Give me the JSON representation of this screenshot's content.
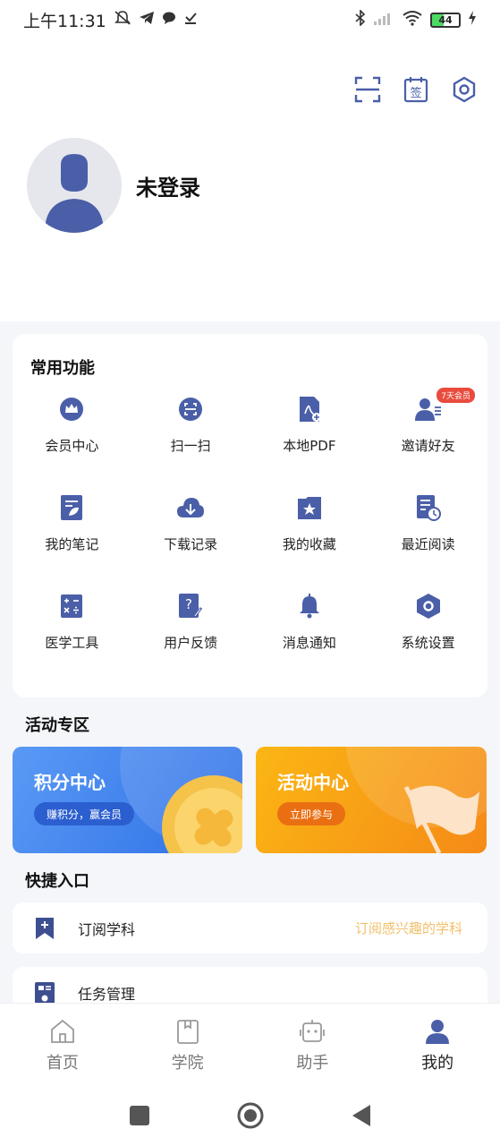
{
  "status_bar": {
    "time": "上午11:31",
    "battery": "44"
  },
  "profile": {
    "login_status": "未登录"
  },
  "top_icons": [
    "scan-icon",
    "sign-in-icon",
    "settings-icon"
  ],
  "functions": {
    "title": "常用功能",
    "badge": "7天会员",
    "items": [
      {
        "label": "会员中心",
        "icon": "crown-icon"
      },
      {
        "label": "扫一扫",
        "icon": "scan-icon"
      },
      {
        "label": "本地PDF",
        "icon": "pdf-icon"
      },
      {
        "label": "邀请好友",
        "icon": "invite-friend-icon"
      },
      {
        "label": "我的笔记",
        "icon": "notes-icon"
      },
      {
        "label": "下载记录",
        "icon": "download-cloud-icon"
      },
      {
        "label": "我的收藏",
        "icon": "favorites-icon"
      },
      {
        "label": "最近阅读",
        "icon": "recent-reading-icon"
      },
      {
        "label": "医学工具",
        "icon": "calculator-icon"
      },
      {
        "label": "用户反馈",
        "icon": "feedback-icon"
      },
      {
        "label": "消息通知",
        "icon": "bell-icon"
      },
      {
        "label": "系统设置",
        "icon": "settings-icon"
      }
    ]
  },
  "activity": {
    "title": "活动专区",
    "points": {
      "title": "积分中心",
      "button": "赚积分，赢会员"
    },
    "events": {
      "title": "活动中心",
      "button": "立即参与"
    }
  },
  "quick": {
    "title": "快捷入口",
    "items": [
      {
        "label": "订阅学科",
        "hint": "订阅感兴趣的学科",
        "icon": "bookmark-plus-icon"
      },
      {
        "label": "任务管理",
        "hint": "",
        "icon": "task-icon"
      }
    ]
  },
  "tabbar": {
    "items": [
      {
        "label": "首页",
        "icon": "home-icon"
      },
      {
        "label": "学院",
        "icon": "college-icon"
      },
      {
        "label": "助手",
        "icon": "robot-icon"
      },
      {
        "label": "我的",
        "icon": "user-icon"
      }
    ],
    "active": "我的"
  },
  "colors": {
    "accent": "#4a5fa8",
    "badge": "#e94b3c",
    "hint": "#f0c06a"
  }
}
